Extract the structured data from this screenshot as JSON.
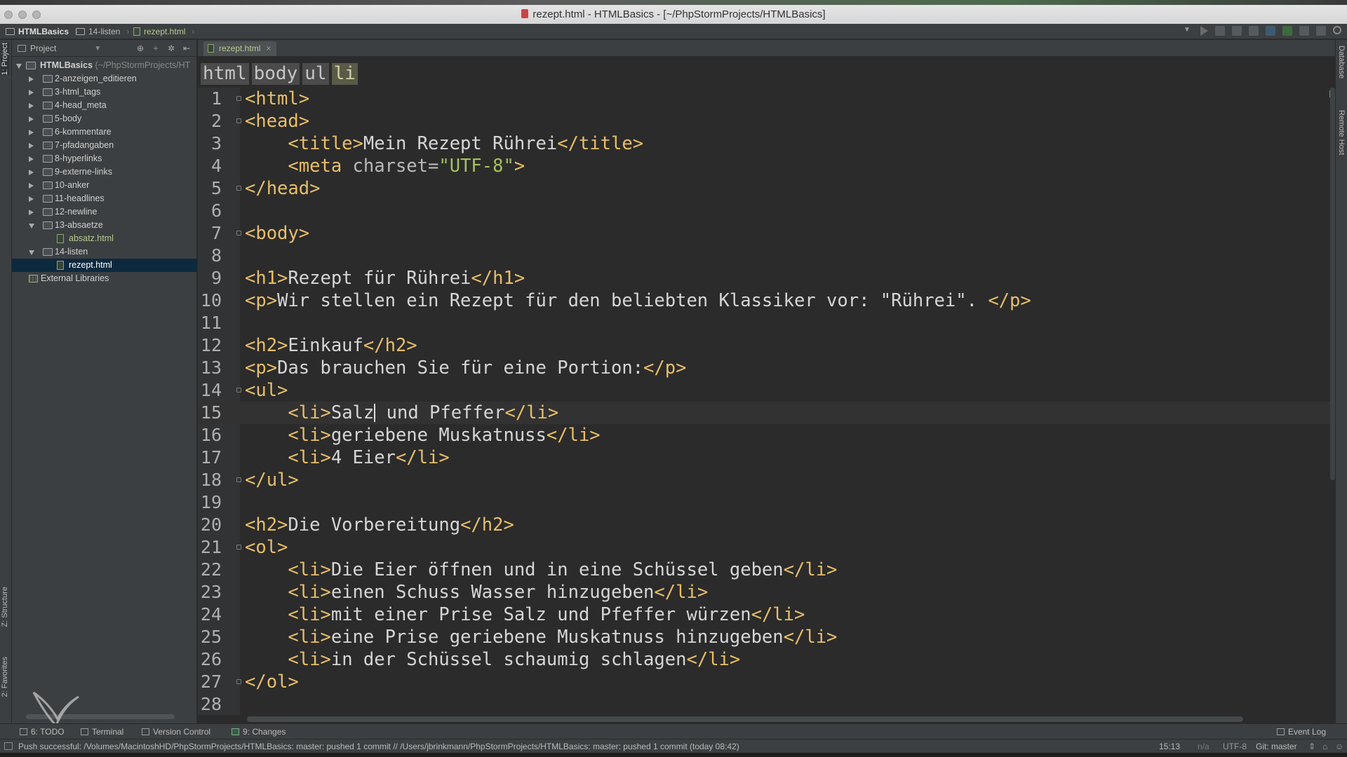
{
  "window": {
    "title": "rezept.html - HTMLBasics - [~/PhpStormProjects/HTMLBasics]"
  },
  "navbar": {
    "crumbs": [
      "HTMLBasics",
      "14-listen",
      "rezept.html"
    ]
  },
  "left_strip": {
    "tabs": [
      "1: Project",
      "Z: Structure",
      "2: Favorites"
    ]
  },
  "right_strip": {
    "tabs": [
      "Database",
      "Remote Host"
    ]
  },
  "project_panel": {
    "selector": "Project",
    "root_name": "HTMLBasics",
    "root_path": "(~/PhpStormProjects/HT",
    "items": [
      "2-anzeigen_editieren",
      "3-html_tags",
      "4-head_meta",
      "5-body",
      "6-kommentare",
      "7-pfadangaben",
      "8-hyperlinks",
      "9-externe-links",
      "10-anker",
      "11-headlines",
      "12-newline",
      "13-absaetze",
      "absatz.html",
      "14-listen",
      "rezept.html",
      "External Libraries"
    ]
  },
  "editor": {
    "tab_label": "rezept.html",
    "tab_close": "×",
    "tag_breadcrumbs": [
      "html",
      "body",
      "ul",
      "li"
    ],
    "line_numbers": [
      "1",
      "2",
      "3",
      "4",
      "5",
      "6",
      "7",
      "8",
      "9",
      "10",
      "11",
      "12",
      "13",
      "14",
      "15",
      "16",
      "17",
      "18",
      "19",
      "20",
      "21",
      "22",
      "23",
      "24",
      "25",
      "26",
      "27",
      "28"
    ],
    "code": {
      "l1": "<html>",
      "l2": "<head>",
      "l3_open": "<title>",
      "l3_text": "Mein Rezept Rührei",
      "l3_close": "</title>",
      "l4_open": "<meta ",
      "l4_attr": "charset=",
      "l4_val": "\"UTF-8\"",
      "l4_close": ">",
      "l5": "</head>",
      "l7": "<body>",
      "l9_open": "<h1>",
      "l9_text": "Rezept für Rührei",
      "l9_close": "</h1>",
      "l10_open": "<p>",
      "l10_text": "Wir stellen ein Rezept für den beliebten Klassiker vor: \"Rührei\". ",
      "l10_close": "</p>",
      "l12_open": "<h2>",
      "l12_text": "Einkauf",
      "l12_close": "</h2>",
      "l13_open": "<p>",
      "l13_text": "Das brauchen Sie für eine Portion:",
      "l13_close": "</p>",
      "l14": "<ul>",
      "l15_open": "<li>",
      "l15_text_a": "Salz",
      "l15_text_b": " und Pfeffer",
      "l15_close": "</li>",
      "l16_open": "<li>",
      "l16_text": "geriebene Muskatnuss",
      "l16_close": "</li>",
      "l17_open": "<li>",
      "l17_text": "4 Eier",
      "l17_close": "</li>",
      "l18": "</ul>",
      "l20_open": "<h2>",
      "l20_text": "Die Vorbereitung",
      "l20_close": "</h2>",
      "l21": "<ol>",
      "l22_open": "<li>",
      "l22_text": "Die Eier öffnen und in eine Schüssel geben",
      "l22_close": "</li>",
      "l23_open": "<li>",
      "l23_text": "einen Schuss Wasser hinzugeben",
      "l23_close": "</li>",
      "l24_open": "<li>",
      "l24_text": "mit einer Prise Salz und Pfeffer würzen",
      "l24_close": "</li>",
      "l25_open": "<li>",
      "l25_text": "eine Prise geriebene Muskatnuss hinzugeben",
      "l25_close": "</li>",
      "l26_open": "<li>",
      "l26_text": "in der Schüssel schaumig schlagen",
      "l26_close": "</li>",
      "l27": "</ol>"
    }
  },
  "bottom_tools": {
    "todo": "6: TODO",
    "terminal": "Terminal",
    "version_control": "Version Control",
    "changes": "9: Changes",
    "event_log": "Event Log"
  },
  "status": {
    "message": "Push successful: /Volumes/MacintoshHD/PhpStormProjects/HTMLBasics: master: pushed 1 commit // /Users/jbrinkmann/PhpStormProjects/HTMLBasics: master: pushed 1 commit (today 08:42)",
    "position": "15:13",
    "na": "n/a",
    "encoding": "UTF-8",
    "git": "Git: master"
  }
}
